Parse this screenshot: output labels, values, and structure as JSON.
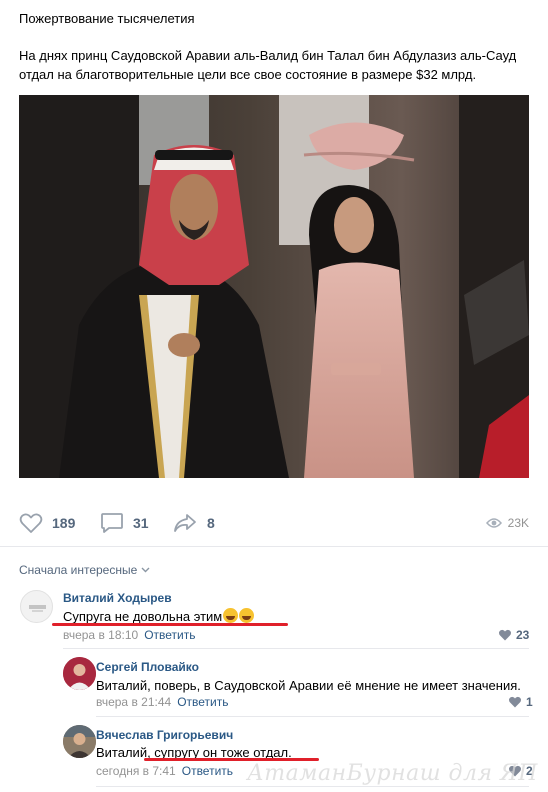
{
  "post": {
    "title": "Пожертвование тысячелетия",
    "text": "На днях принц Саудовской Аравии аль-Валид бин Талал бин Абдулазиз аль-Сауд отдал на благотворительные цели все свое состояние в размере $32 млрд."
  },
  "actions": {
    "likes": "189",
    "comments": "31",
    "shares": "8",
    "views": "23K"
  },
  "comments_sort": "Сначала интересные",
  "comments": [
    {
      "author": "Виталий Ходырев",
      "text": "Супруга не довольна этим",
      "time": "вчера в 18:10",
      "reply": "Ответить",
      "likes": "23"
    },
    {
      "author": "Сергей Пловайко",
      "text": "Виталий, поверь, в Саудовской Аравии её мнение не имеет значения.",
      "time": "вчера в 21:44",
      "reply": "Ответить",
      "likes": "1"
    },
    {
      "author": "Вячеслав Григорьевич",
      "text": "Виталий, супругу он тоже отдал.",
      "time": "сегодня в 7:41",
      "reply": "Ответить",
      "likes": "2"
    }
  ],
  "watermark": "АтаманБурнаш для ЯП",
  "colors": {
    "link": "#2a5885",
    "action": "#55677d",
    "muted": "#939393",
    "underline": "#e0202a"
  }
}
